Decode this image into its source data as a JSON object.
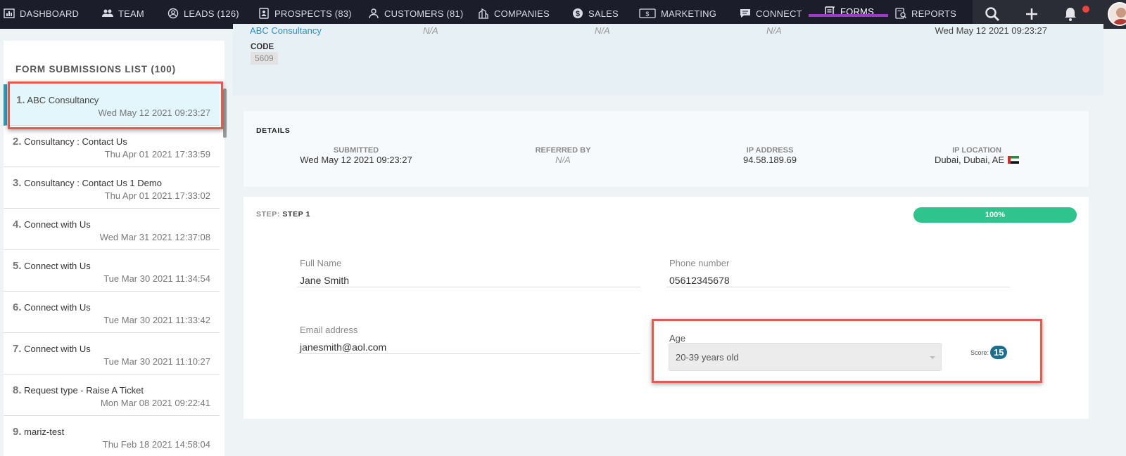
{
  "nav": {
    "items": [
      {
        "label": "DASHBOARD",
        "icon": "dashboard-icon"
      },
      {
        "label": "TEAM",
        "icon": "team-icon"
      },
      {
        "label": "LEADS (126)",
        "icon": "leads-icon"
      },
      {
        "label": "PROSPECTS (83)",
        "icon": "prospects-icon"
      },
      {
        "label": "CUSTOMERS (81)",
        "icon": "customers-icon"
      },
      {
        "label": "COMPANIES",
        "icon": "companies-icon"
      },
      {
        "label": "SALES",
        "icon": "sales-icon"
      },
      {
        "label": "MARKETING",
        "icon": "marketing-icon"
      },
      {
        "label": "CONNECT",
        "icon": "connect-icon"
      },
      {
        "label": "FORMS",
        "icon": "forms-icon",
        "active": true
      },
      {
        "label": "REPORTS",
        "icon": "reports-icon"
      }
    ],
    "right_icons": [
      "search-icon",
      "plus-icon",
      "bell-icon",
      "user-avatar"
    ]
  },
  "submissions": {
    "title": "FORM SUBMISSIONS LIST (100)",
    "items": [
      {
        "num": "1.",
        "title": "ABC Consultancy",
        "date": "Wed May 12 2021 09:23:27"
      },
      {
        "num": "2.",
        "title": "Consultancy : Contact Us",
        "date": "Thu Apr 01 2021 17:33:59"
      },
      {
        "num": "3.",
        "title": "Consultancy : Contact Us 1 Demo",
        "date": "Thu Apr 01 2021 17:33:02"
      },
      {
        "num": "4.",
        "title": "Connect with Us",
        "date": "Wed Mar 31 2021 12:37:08"
      },
      {
        "num": "5.",
        "title": "Connect with Us",
        "date": "Tue Mar 30 2021 11:34:54"
      },
      {
        "num": "6.",
        "title": "Connect with Us",
        "date": "Tue Mar 30 2021 11:33:42"
      },
      {
        "num": "7.",
        "title": "Connect with Us",
        "date": "Tue Mar 30 2021 11:10:27"
      },
      {
        "num": "8.",
        "title": "Request type - Raise A Ticket",
        "date": "Mon Mar 08 2021 09:22:41"
      },
      {
        "num": "9.",
        "title": "mariz-test",
        "date": "Thu Feb 18 2021 14:58:04"
      }
    ]
  },
  "top_section": {
    "link": "ABC Consultancy",
    "na1": "N/A",
    "na2": "N/A",
    "na3": "N/A",
    "date": "Wed May 12 2021 09:23:27",
    "code_label": "CODE",
    "code_value": "5609"
  },
  "details": {
    "header": "DETAILS",
    "submitted_label": "SUBMITTED",
    "submitted_value": "Wed May 12 2021 09:23:27",
    "referred_label": "REFERRED BY",
    "referred_value": "N/A",
    "ip_label": "IP ADDRESS",
    "ip_value": "94.58.189.69",
    "loc_label": "IP LOCATION",
    "loc_value": "Dubai, Dubai, AE"
  },
  "step": {
    "label": "STEP:",
    "name": "STEP 1",
    "progress": "100%",
    "fields": {
      "full_name_label": "Full Name",
      "full_name_value": "Jane Smith",
      "phone_label": "Phone number",
      "phone_value": "05612345678",
      "email_label": "Email address",
      "email_value": "janesmith@aol.com",
      "age_label": "Age",
      "age_value": "20-39 years old",
      "score_label": "Score:",
      "score_value": "15"
    }
  }
}
